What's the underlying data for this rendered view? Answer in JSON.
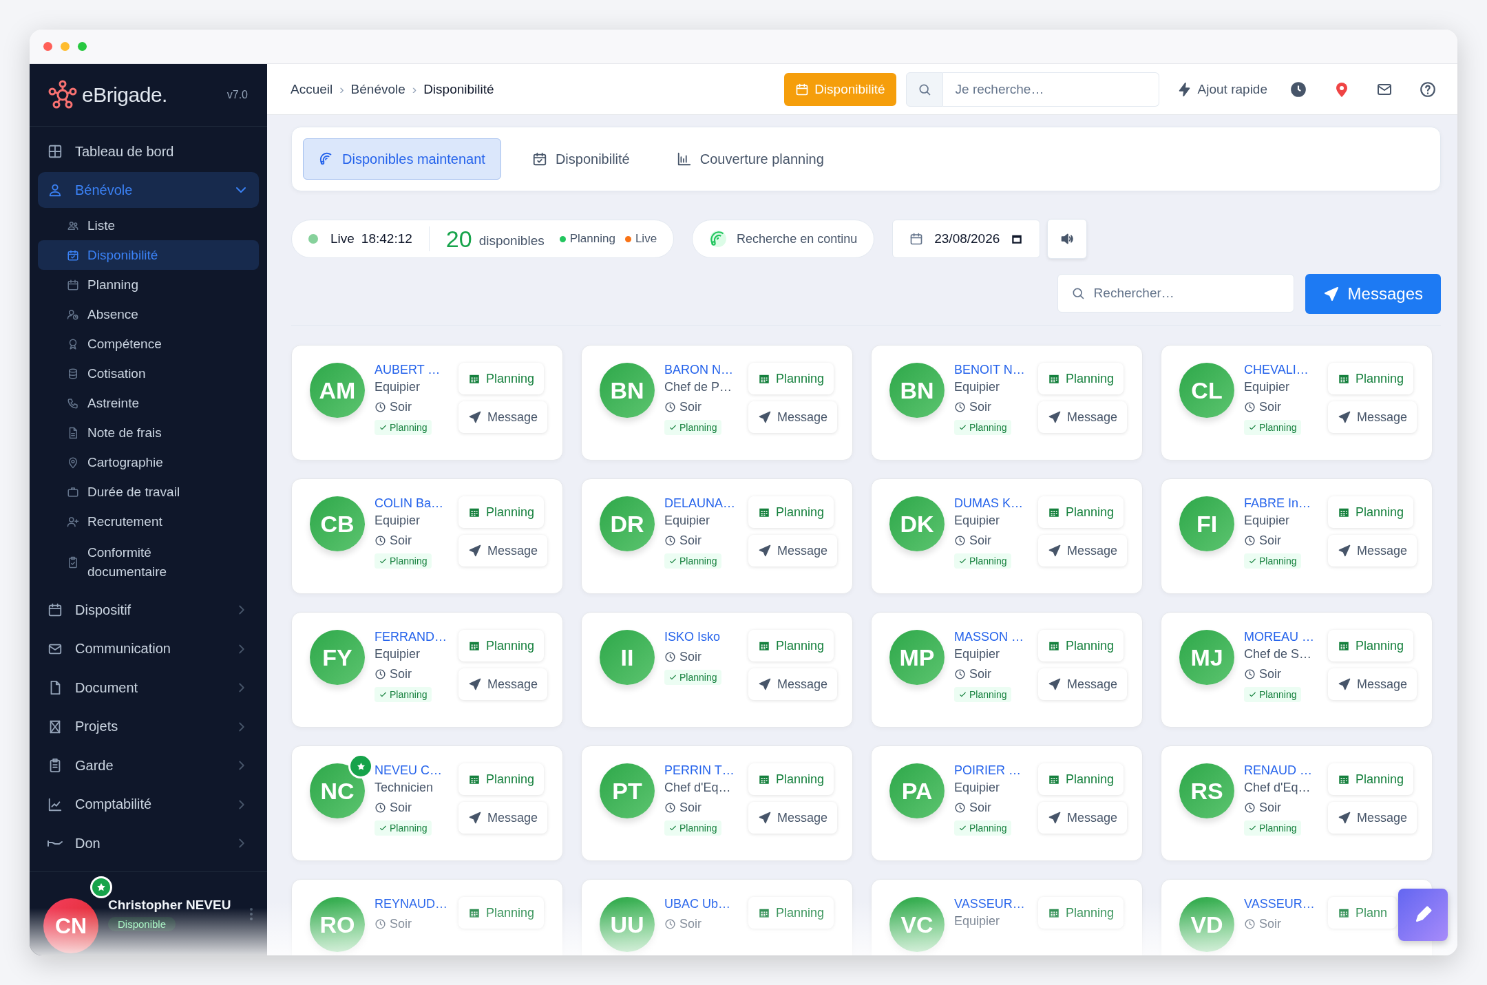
{
  "sidebar": {
    "brand": "eBrigade.",
    "version": "v7.0",
    "items": [
      {
        "kind": "link",
        "label": "Tableau de bord",
        "selected": false
      },
      {
        "kind": "group",
        "label": "Bénévole",
        "selected": true,
        "expanded": true,
        "children": [
          {
            "label": "Liste",
            "selected": false
          },
          {
            "label": "Disponibilité",
            "selected": true
          },
          {
            "label": "Planning",
            "selected": false
          },
          {
            "label": "Absence",
            "selected": false
          },
          {
            "label": "Compétence",
            "selected": false
          },
          {
            "label": "Cotisation",
            "selected": false
          },
          {
            "label": "Astreinte",
            "selected": false
          },
          {
            "label": "Note de frais",
            "selected": false
          },
          {
            "label": "Cartographie",
            "selected": false
          },
          {
            "label": "Durée de travail",
            "selected": false
          },
          {
            "label": "Recrutement",
            "selected": false
          },
          {
            "label": "Conformité documentaire",
            "selected": false
          }
        ]
      },
      {
        "kind": "group",
        "label": "Dispositif",
        "selected": false,
        "expanded": false
      },
      {
        "kind": "group",
        "label": "Communication",
        "selected": false,
        "expanded": false
      },
      {
        "kind": "group",
        "label": "Document",
        "selected": false,
        "expanded": false
      },
      {
        "kind": "group",
        "label": "Projets",
        "selected": false,
        "expanded": false
      },
      {
        "kind": "group",
        "label": "Garde",
        "selected": false,
        "expanded": false
      },
      {
        "kind": "group",
        "label": "Comptabilité",
        "selected": false,
        "expanded": false
      },
      {
        "kind": "group",
        "label": "Don",
        "selected": false,
        "expanded": false
      }
    ],
    "user": {
      "initials": "CN",
      "name": "Christopher NEVEU",
      "status": "Disponible"
    }
  },
  "header": {
    "breadcrumb": [
      {
        "label": "Accueil"
      },
      {
        "label": "Bénévole"
      },
      {
        "label": "Disponibilité"
      }
    ],
    "separator": "›",
    "action": "Disponibilité",
    "search": {
      "placeholder": "Je recherche…"
    },
    "quick_add": "Ajout rapide"
  },
  "tabs": [
    {
      "label": "Disponibles maintenant",
      "selected": true
    },
    {
      "label": "Disponibilité",
      "selected": false
    },
    {
      "label": "Couverture planning",
      "selected": false
    }
  ],
  "live": {
    "label": "Live",
    "time": "18:42:12",
    "count": "20",
    "count_label": "disponibles",
    "legend": [
      {
        "label": "Planning",
        "color": "#22c55e"
      },
      {
        "label": "Live",
        "color": "#f97316"
      }
    ]
  },
  "continuous": "Recherche en continu",
  "date": "23/08/2026",
  "search": {
    "placeholder": "Rechercher…"
  },
  "messages_button": "Messages",
  "cards": [
    {
      "initials": "AM",
      "name": "AUBERT …",
      "role": "Equipier",
      "shift": "Soir",
      "badge": "Planning",
      "featured": false,
      "buttons": [
        "Planning",
        "Message"
      ]
    },
    {
      "initials": "BN",
      "name": "BARON N…",
      "role": "Chef de P…",
      "shift": "Soir",
      "badge": "Planning",
      "featured": false,
      "buttons": [
        "Planning",
        "Message"
      ]
    },
    {
      "initials": "BN",
      "name": "BENOIT N…",
      "role": "Equipier",
      "shift": "Soir",
      "badge": "Planning",
      "featured": false,
      "buttons": [
        "Planning",
        "Message"
      ]
    },
    {
      "initials": "CL",
      "name": "CHEVALI…",
      "role": "Equipier",
      "shift": "Soir",
      "badge": "Planning",
      "featured": false,
      "buttons": [
        "Planning",
        "Message"
      ]
    },
    {
      "initials": "CB",
      "name": "COLIN Ba…",
      "role": "Equipier",
      "shift": "Soir",
      "badge": "Planning",
      "featured": false,
      "buttons": [
        "Planning",
        "Message"
      ]
    },
    {
      "initials": "DR",
      "name": "DELAUNA…",
      "role": "Equipier",
      "shift": "Soir",
      "badge": "Planning",
      "featured": false,
      "buttons": [
        "Planning",
        "Message"
      ]
    },
    {
      "initials": "DK",
      "name": "DUMAS K…",
      "role": "Equipier",
      "shift": "Soir",
      "badge": "Planning",
      "featured": false,
      "buttons": [
        "Planning",
        "Message"
      ]
    },
    {
      "initials": "FI",
      "name": "FABRE In…",
      "role": "Equipier",
      "shift": "Soir",
      "badge": "Planning",
      "featured": false,
      "buttons": [
        "Planning",
        "Message"
      ]
    },
    {
      "initials": "FY",
      "name": "FERRAND…",
      "role": "Equipier",
      "shift": "Soir",
      "badge": "Planning",
      "featured": false,
      "buttons": [
        "Planning",
        "Message"
      ]
    },
    {
      "initials": "II",
      "name": "ISKO Isko",
      "shift": "Soir",
      "badge": "Planning",
      "featured": false,
      "buttons": [
        "Planning",
        "Message"
      ]
    },
    {
      "initials": "MP",
      "name": "MASSON …",
      "role": "Equipier",
      "shift": "Soir",
      "badge": "Planning",
      "featured": false,
      "buttons": [
        "Planning",
        "Message"
      ]
    },
    {
      "initials": "MJ",
      "name": "MOREAU …",
      "role": "Chef de S…",
      "shift": "Soir",
      "badge": "Planning",
      "featured": false,
      "buttons": [
        "Planning",
        "Message"
      ]
    },
    {
      "initials": "NC",
      "name": "NEVEU C…",
      "role": "Technicien",
      "shift": "Soir",
      "badge": "Planning",
      "featured": true,
      "buttons": [
        "Planning",
        "Message"
      ]
    },
    {
      "initials": "PT",
      "name": "PERRIN T…",
      "role": "Chef d'Eq…",
      "shift": "Soir",
      "badge": "Planning",
      "featured": false,
      "buttons": [
        "Planning",
        "Message"
      ]
    },
    {
      "initials": "PA",
      "name": "POIRIER …",
      "role": "Equipier",
      "shift": "Soir",
      "badge": "Planning",
      "featured": false,
      "buttons": [
        "Planning",
        "Message"
      ]
    },
    {
      "initials": "RS",
      "name": "RENAUD …",
      "role": "Chef d'Eq…",
      "shift": "Soir",
      "badge": "Planning",
      "featured": false,
      "buttons": [
        "Planning",
        "Message"
      ]
    },
    {
      "initials": "RO",
      "name": "REYNAUD…",
      "shift": "Soir",
      "featured": false,
      "buttons": [
        "Planning"
      ]
    },
    {
      "initials": "UU",
      "name": "UBAC Ub…",
      "shift": "Soir",
      "featured": false,
      "buttons": [
        "Planning"
      ]
    },
    {
      "initials": "VC",
      "name": "VASSEUR…",
      "role": "Equipier",
      "featured": false,
      "buttons": [
        "Planning"
      ]
    },
    {
      "initials": "VD",
      "name": "VASSEUR…",
      "shift": "Soir",
      "featured": false,
      "buttons": [
        "Plann"
      ]
    }
  ]
}
